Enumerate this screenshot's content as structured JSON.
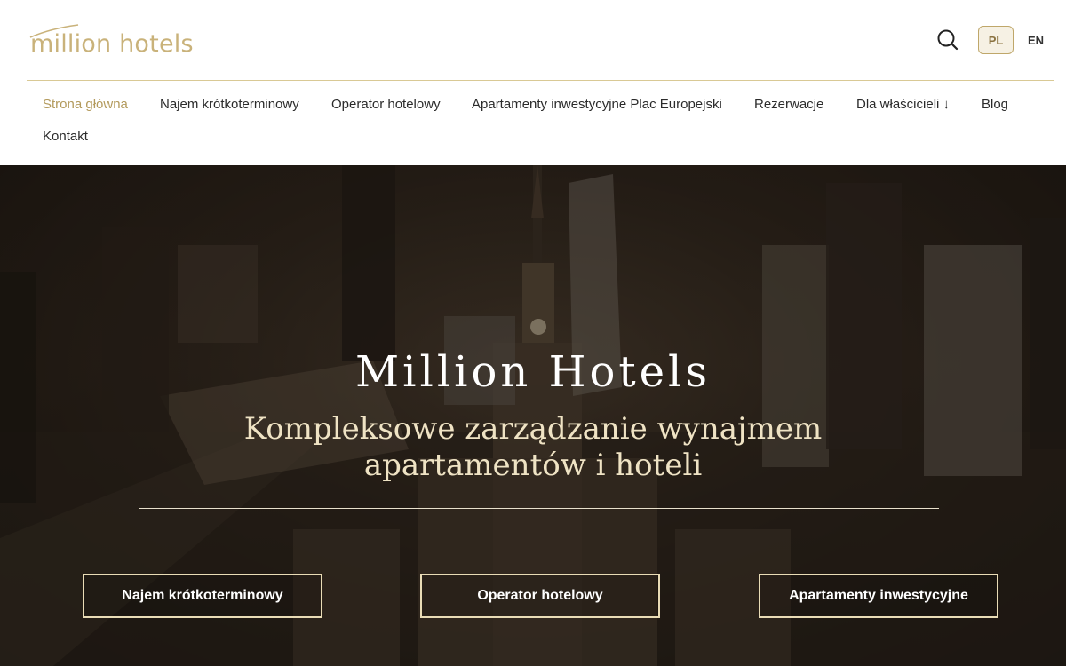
{
  "header": {
    "logo_text": "million hotels",
    "search_icon": "search-icon",
    "languages": {
      "pl": "PL",
      "en": "EN",
      "active": "PL"
    }
  },
  "nav": {
    "items": [
      {
        "label": "Strona główna",
        "active": true
      },
      {
        "label": "Najem krótkoterminowy",
        "active": false
      },
      {
        "label": "Operator hotelowy",
        "active": false
      },
      {
        "label": "Apartamenty inwestycyjne Plac Europejski",
        "active": false
      },
      {
        "label": "Rezerwacje",
        "active": false
      },
      {
        "label": "Dla właścicieli ↓",
        "active": false
      },
      {
        "label": "Blog",
        "active": false
      },
      {
        "label": "Kontakt",
        "active": false
      }
    ]
  },
  "hero": {
    "title": "Million Hotels",
    "subtitle_line1": "Kompleksowe zarządzanie wynajmem",
    "subtitle_line2": "apartamentów i hoteli",
    "buttons": [
      {
        "label": "Najem krótkoterminowy"
      },
      {
        "label": "Operator hotelowy"
      },
      {
        "label": "Apartamenty inwestycyjne"
      }
    ]
  },
  "colors": {
    "accent_gold": "#c9b27a",
    "active_nav": "#b39a5c",
    "text_dark": "#2b2b2b",
    "hero_subtitle": "#efe3c4"
  }
}
